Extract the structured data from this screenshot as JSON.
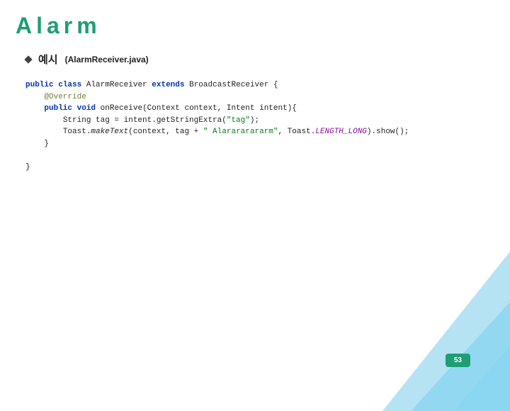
{
  "title": "Alarm",
  "bullet": {
    "label": "예시",
    "file": "(AlarmReceiver.java)"
  },
  "code": {
    "kw_public": "public",
    "kw_class": "class",
    "cls_name": "AlarmReceiver",
    "kw_extends": "extends",
    "base_cls": "BroadcastReceiver",
    "brace_open": "{",
    "annotation": "@Override",
    "kw_void": "void",
    "method": "onReceive",
    "params": "(Context context, Intent intent){",
    "line3a": "String tag = intent.getStringExtra(",
    "str_tag": "\"tag\"",
    "line3b": ");",
    "line4a": "Toast.",
    "line4_make": "makeText",
    "line4b": "(context, tag + ",
    "str_alarm": "\" Alarararararm\"",
    "line4c": ", Toast.",
    "const_len": "LENGTH_LONG",
    "line4d": ").show();",
    "brace_close_inner": "}",
    "brace_close_outer": "}"
  },
  "page_number": "53",
  "colors": {
    "accent": "#1E9E74"
  }
}
